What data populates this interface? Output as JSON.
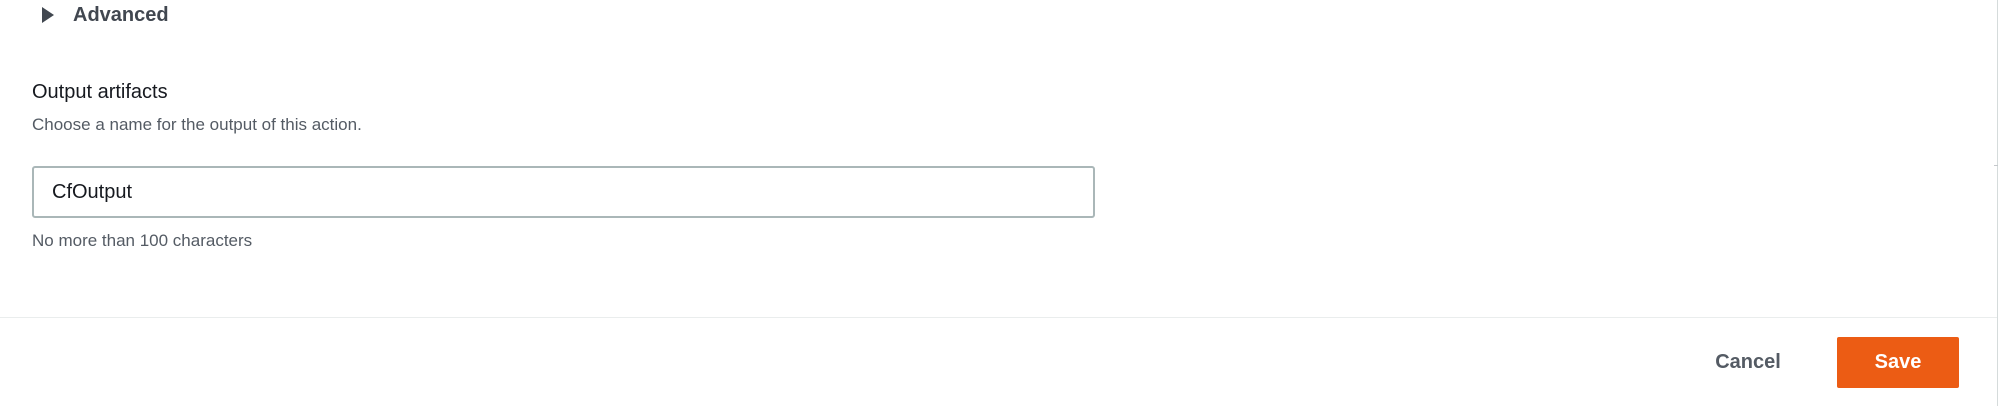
{
  "advanced": {
    "label": "Advanced",
    "icon": "caret-right-icon"
  },
  "output_artifacts": {
    "title": "Output artifacts",
    "description": "Choose a name for the output of this action.",
    "value": "CfOutput",
    "constraint": "No more than 100 characters"
  },
  "footer": {
    "cancel_label": "Cancel",
    "save_label": "Save"
  },
  "colors": {
    "primary_button": "#ec5c14",
    "text": "#16191f",
    "secondary_text": "#545b64",
    "input_border": "#aab7b8"
  }
}
